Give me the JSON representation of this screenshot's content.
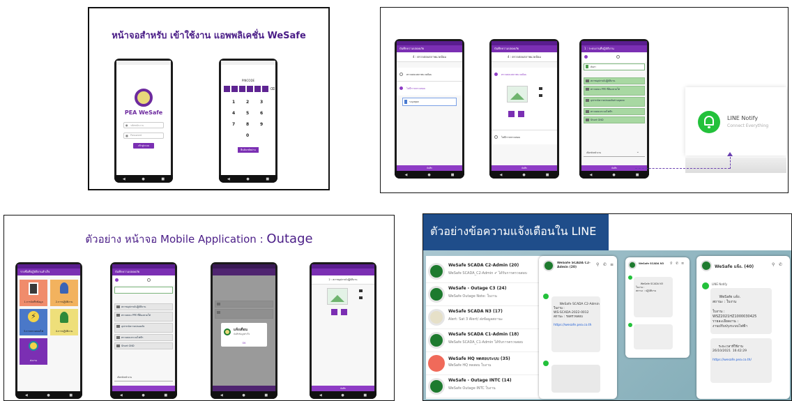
{
  "panel1": {
    "title": "หน้าจอสำหรับ เข้าใช้งาน แอพพลิเคชั่น WeSafe",
    "login": {
      "logo_text": "PEA WeSafe",
      "user_placeholder": "รหัสพนักงาน",
      "password_placeholder": "Password",
      "login_button": "เข้าสู่ระบบ"
    },
    "pin": {
      "heading": "PINCODE",
      "keys": [
        "1",
        "2",
        "3",
        "4",
        "5",
        "6",
        "7",
        "8",
        "9",
        "0"
      ],
      "confirm_button": "ยืนยันรหัสผ่าน"
    }
  },
  "panel2": {
    "phone1": {
      "appbar": "บันทึกความปลอดภัย",
      "step": "4 : ตรวจสอบสภาพแวดล้อม",
      "option_a": "ตรวจสอบสภาพแวดล้อม",
      "option_b": "ไม่มีการตรวจสอบ",
      "input_value": "ระบุเหตุผล",
      "bottom": "บันทึก"
    },
    "phone2": {
      "appbar": "บันทึกความปลอดภัย",
      "step": "4 : ตรวจสอบสภาพแวดล้อม",
      "option_a": "ตรวจสอบสภาพแวดล้อม",
      "option_b": "ไม่มีการตรวจสอบ",
      "bottom": "บันทึก"
    },
    "phone3": {
      "appbar": "1 : ระบบงานที่ปฏิบัติงาน",
      "search_value": "ค้นหา",
      "items": [
        "สภาพอุปกรณ์ปฏิบัติงาน",
        "ตรวจสอบ PPE ที่ต้องสวมใส่",
        "อุปกรณ์ความปลอดภัยส่วนบุคคล",
        "ตรวจสอบระบบไฟฟ้า",
        "Short GND"
      ],
      "select_label": "เลือกหัวหน้างาน",
      "bottom": "บันทึก"
    },
    "line_notify": {
      "title": "LINE Notify",
      "subtitle": "Connect Everything"
    }
  },
  "panel3": {
    "title_thai": "ตัวอย่าง หน้าจอ Mobile Application : ",
    "title_en": "Outage",
    "menu_phone": {
      "appbar": "รายชื่อที่ปฏิบัติงานสำเร็จ",
      "tiles": [
        {
          "label": "1.การบันทึกข้อมูล",
          "color": "#f08c6c"
        },
        {
          "label": "2.การปฏิบัติงาน",
          "color": "#f2b25e"
        },
        {
          "label": "3.การตรวจสอบไฟ",
          "color": "#4a78c8"
        },
        {
          "label": "4.การปฏิบัติงาน",
          "color": "#eedf7a"
        },
        {
          "label": "ส่งงาน",
          "color": "#7b2fb3"
        }
      ]
    },
    "list_phone": {
      "appbar": "บันทึกความปลอดภัย",
      "items": [
        "สภาพอุปกรณ์ปฏิบัติงาน",
        "ตรวจสอบ PPE ที่ต้องสวมใส่",
        "อุปกรณ์ความปลอดภัย",
        "ตรวจสอบระบบไฟฟ้า",
        "Short GND"
      ],
      "select_label": "เลือกหัวหน้างาน"
    },
    "dialog_phone": {
      "dialog_title": "แจ้งเตือน",
      "dialog_text": "บันทึกข้อมูลสำเร็จ",
      "dialog_button": "OK"
    },
    "photo_phone": {
      "step": "2 : สภาพอุปกรณ์ปฏิบัติงาน",
      "bottom": "บันทึก"
    }
  },
  "panel4": {
    "title": "ตัวอย่างข้อความแจ้งเตือนใน LINE",
    "chat_list": [
      {
        "name": "WeSafe SCADA C2-Admin (20)",
        "msg": "WeSafe SCADA_C2-Admin ✔ ได้รับการตรวจสอบ",
        "avatar": "#1d7a2e"
      },
      {
        "name": "WeSafe - Outage C3 (24)",
        "msg": "WeSafe Outage Note: ใบงาน",
        "avatar": "#1d7a2e"
      },
      {
        "name": "WeSafe SCADA N3 (17)",
        "msg": "Alert: Sat 3 Alert/ ส่งข้อมูลสถานะ",
        "avatar": "#e6e0c8"
      },
      {
        "name": "WeSafe SCADA C1-Admin (18)",
        "msg": "WeSafe SCADA_C1-Admin ได้รับการตรวจสอบ",
        "avatar": "#1d7a2e"
      },
      {
        "name": "WeSafe HQ ทดสอบระบบ (35)",
        "msg": "WeSafe HQ ทดสอบ ใบงาน",
        "avatar": "#f06a5a"
      },
      {
        "name": "WeSafe - Outage INTC (14)",
        "msg": "WeSafe Outage INTC ใบงาน",
        "avatar": "#1d7a2e"
      }
    ],
    "chat_a": {
      "header": "WeSafe SCADA C2-Admin (20)",
      "bubble": "WeSafe SCADA C2-Admin\nใบงาน :\nWS-SCADA-2022-0012\nสถานะ : รอตรวจสอบ",
      "link": "https://wesafe.pea.co.th"
    },
    "chat_b": {
      "header": "WeSafe SCADA N3",
      "bubble": "WeSafe SCADA N3\nใบงาน :\nสถานะ : ปฏิบัติงาน"
    },
    "chat_c": {
      "header": "WeSafe แจ้ง. (40)",
      "sender": "LINE Notify",
      "bubble1": "WeSafe แจ้ง.\nสถานะ : ใบงาน\n\nใบงาน :\nWSZ2021HZ1000030425\nรายละเอียดงาน :\nงานปรับปรุงระบบไฟฟ้า",
      "bubble2": "ระยะเวลาที่ใช้งาน\n26/10/2021  16:42:29",
      "link": "https://wesafe.pea.co.th/"
    }
  }
}
